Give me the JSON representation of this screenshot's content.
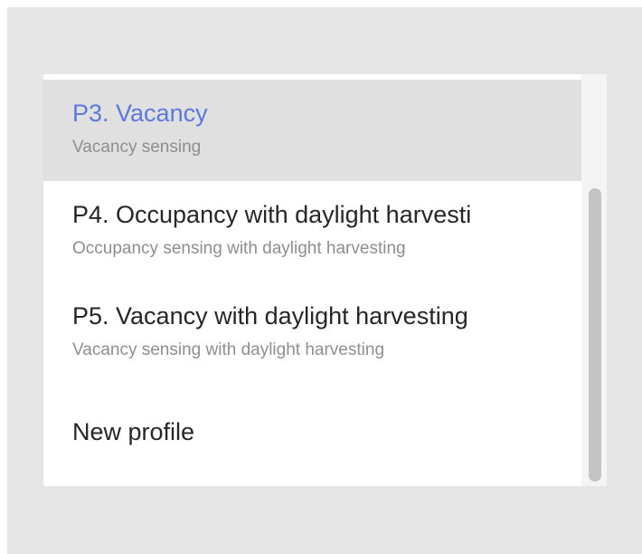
{
  "profiles": {
    "items": [
      {
        "title": "P3. Vacancy",
        "subtitle": "Vacancy sensing",
        "selected": true
      },
      {
        "title": "P4. Occupancy with daylight harvesti",
        "subtitle": "Occupancy sensing with daylight harvesting",
        "selected": false
      },
      {
        "title": "P5. Vacancy with daylight harvesting",
        "subtitle": "Vacancy sensing with daylight harvesting",
        "selected": false
      }
    ],
    "new_profile_label": "New profile"
  },
  "colors": {
    "accent": "#5c78e0",
    "selected_background": "#e0e0e0",
    "backdrop": "#e6e6e6"
  }
}
